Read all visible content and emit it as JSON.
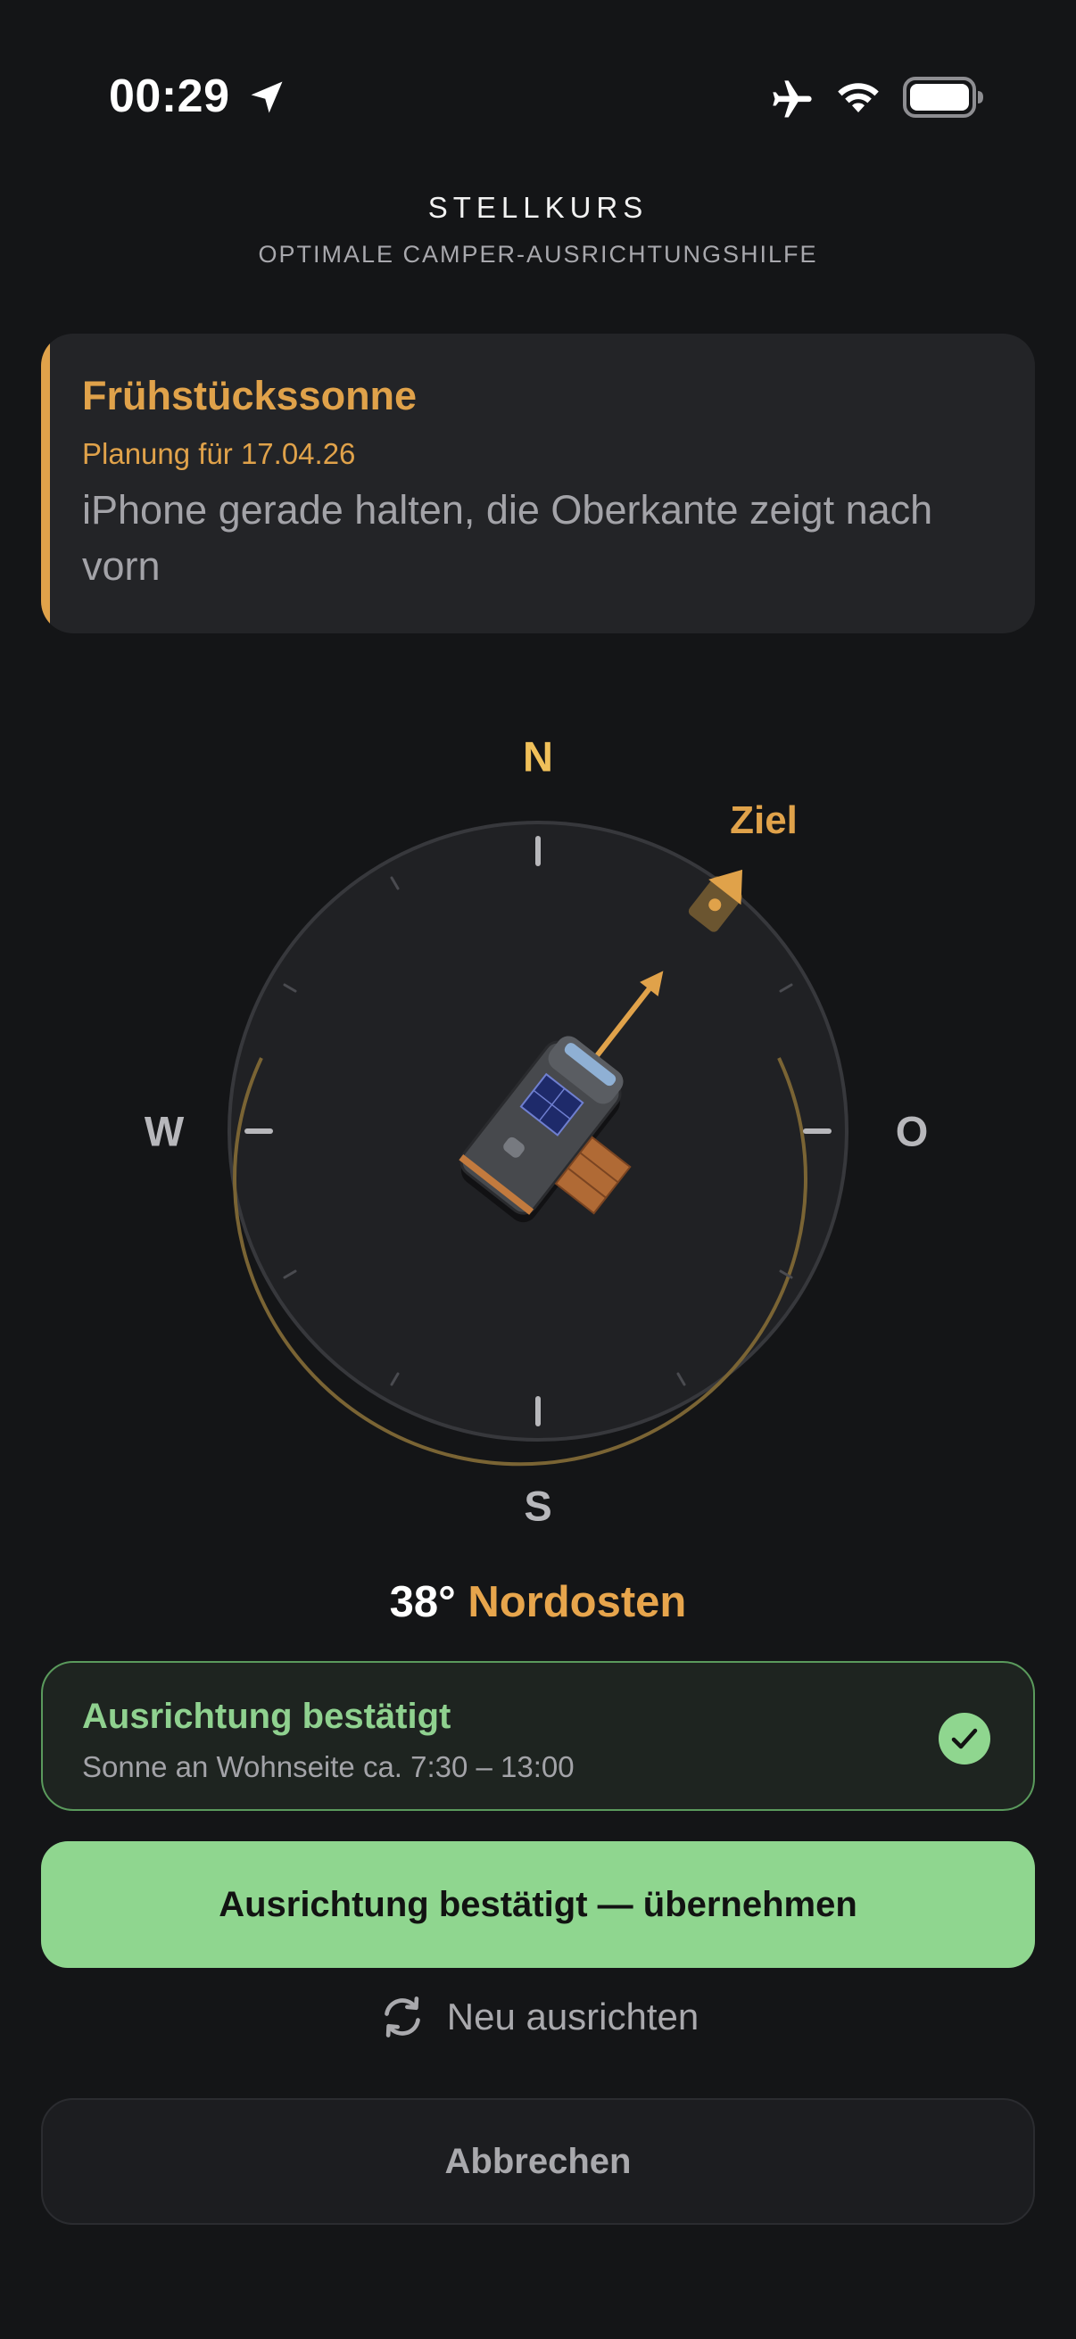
{
  "status_bar": {
    "time": "00:29",
    "icons": [
      "location-arrow-icon",
      "airplane-icon",
      "wifi-icon",
      "battery-icon"
    ]
  },
  "header": {
    "title": "STELLKURS",
    "subtitle": "OPTIMALE CAMPER-AUSRICHTUNGSHILFE"
  },
  "info_card": {
    "title": "Frühstückssonne",
    "date": "Planung für 17.04.26",
    "instruction": "iPhone gerade halten, die Oberkante zeigt nach vorn"
  },
  "compass": {
    "north": "N",
    "east": "O",
    "south": "S",
    "west": "W",
    "target_label": "Ziel",
    "heading_deg": 38
  },
  "heading": {
    "degrees": "38°",
    "direction": "Nordosten"
  },
  "confirmation": {
    "title": "Ausrichtung bestätigt",
    "subtitle": "Sonne an Wohnseite ca. 7:30 – 13:00"
  },
  "actions": {
    "primary": "Ausrichtung bestätigt — übernehmen",
    "realign": "Neu ausrichten",
    "cancel": "Abbrechen"
  },
  "colors": {
    "background": "#141517",
    "accent_orange": "#e0a24a",
    "north_yellow": "#f0c05a",
    "success_green": "#8fd68f"
  }
}
